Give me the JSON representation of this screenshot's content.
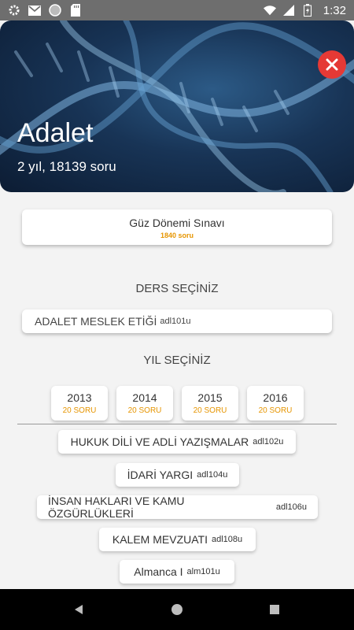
{
  "status_bar": {
    "time": "1:32",
    "icons": [
      "gear-icon",
      "gmail-icon",
      "circle-icon",
      "sd-card-icon",
      "wifi-icon",
      "cell-signal-icon",
      "battery-charging-icon"
    ]
  },
  "header": {
    "title": "Adalet",
    "subtitle": "2 yıl, 18139 soru",
    "close_icon": "close-icon"
  },
  "exam": {
    "label": "Güz Dönemi Sınavı",
    "count": "1840 soru"
  },
  "course_section": {
    "heading": "DERS SEÇİNİZ",
    "selected_name": "ADALET MESLEK ETİĞİ",
    "selected_code": "adl101u"
  },
  "year_section": {
    "heading": "YIL SEÇİNİZ",
    "years": [
      {
        "year": "2013",
        "count": "20 SORU"
      },
      {
        "year": "2014",
        "count": "20 SORU"
      },
      {
        "year": "2015",
        "count": "20 SORU"
      },
      {
        "year": "2016",
        "count": "20 SORU"
      }
    ]
  },
  "courses": [
    {
      "name": "HUKUK DİLİ VE ADLİ YAZIŞMALAR",
      "code": "adl102u"
    },
    {
      "name": "İDARİ YARGI",
      "code": "adl104u"
    },
    {
      "name": "İNSAN HAKLARI VE KAMU ÖZGÜRLÜKLERİ",
      "code": "adl106u"
    },
    {
      "name": "KALEM MEVZUATI",
      "code": "adl108u"
    },
    {
      "name": "Almanca I",
      "code": "alm101u"
    }
  ],
  "nav_bar": {
    "icons": [
      "back-icon",
      "home-icon",
      "recents-icon"
    ]
  },
  "colors": {
    "accent_orange": "#e69500",
    "close_red": "#e53935",
    "status_bar": "#6e6e6e"
  }
}
